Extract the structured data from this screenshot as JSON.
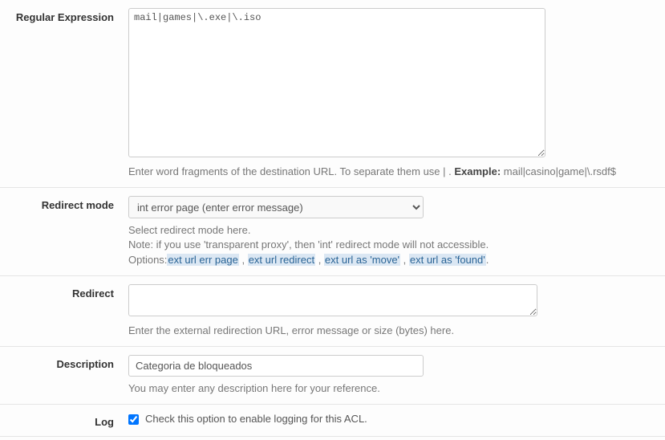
{
  "regex": {
    "label": "Regular Expression",
    "value": "mail|games|\\.exe|\\.iso",
    "help_prefix": "Enter word fragments of the destination URL. To separate them use | . ",
    "help_example_label": "Example:",
    "help_example_value": " mail|casino|game|\\.rsdf$"
  },
  "redirect_mode": {
    "label": "Redirect mode",
    "selected": "int error page (enter error message)",
    "help_line1": "Select redirect mode here.",
    "help_line2": "Note: if you use 'transparent proxy', then 'int' redirect mode will not accessible.",
    "help_options_prefix": "Options:",
    "options_links": {
      "a": "ext url err page",
      "b": "ext url redirect",
      "c": "ext url as 'move'",
      "d": "ext url as 'found'"
    },
    "sep": " , ",
    "period": "."
  },
  "redirect": {
    "label": "Redirect",
    "value": "",
    "help": "Enter the external redirection URL, error message or size (bytes) here."
  },
  "description": {
    "label": "Description",
    "value": "Categoria de bloqueados",
    "help": "You may enter any description here for your reference."
  },
  "log": {
    "label": "Log",
    "checked": true,
    "text": "Check this option to enable logging for this ACL."
  }
}
